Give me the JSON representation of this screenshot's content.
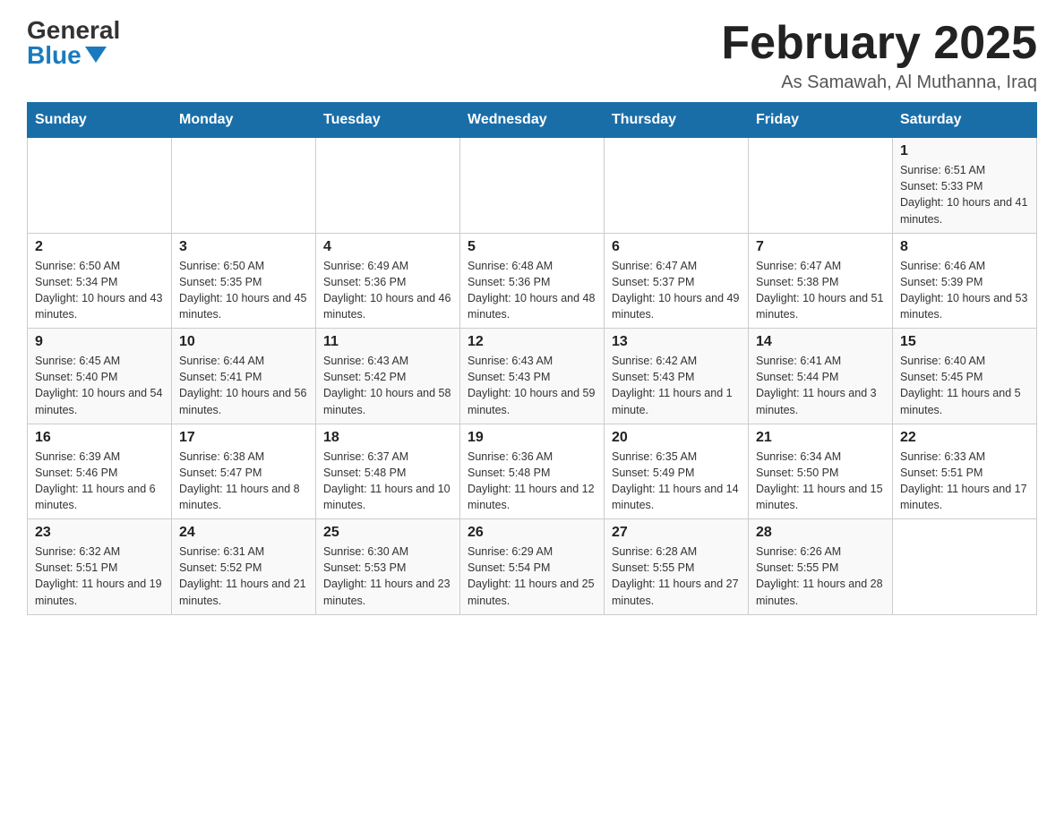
{
  "logo": {
    "general": "General",
    "blue": "Blue"
  },
  "title": "February 2025",
  "location": "As Samawah, Al Muthanna, Iraq",
  "weekdays": [
    "Sunday",
    "Monday",
    "Tuesday",
    "Wednesday",
    "Thursday",
    "Friday",
    "Saturday"
  ],
  "weeks": [
    [
      {
        "day": "",
        "info": ""
      },
      {
        "day": "",
        "info": ""
      },
      {
        "day": "",
        "info": ""
      },
      {
        "day": "",
        "info": ""
      },
      {
        "day": "",
        "info": ""
      },
      {
        "day": "",
        "info": ""
      },
      {
        "day": "1",
        "info": "Sunrise: 6:51 AM\nSunset: 5:33 PM\nDaylight: 10 hours and 41 minutes."
      }
    ],
    [
      {
        "day": "2",
        "info": "Sunrise: 6:50 AM\nSunset: 5:34 PM\nDaylight: 10 hours and 43 minutes."
      },
      {
        "day": "3",
        "info": "Sunrise: 6:50 AM\nSunset: 5:35 PM\nDaylight: 10 hours and 45 minutes."
      },
      {
        "day": "4",
        "info": "Sunrise: 6:49 AM\nSunset: 5:36 PM\nDaylight: 10 hours and 46 minutes."
      },
      {
        "day": "5",
        "info": "Sunrise: 6:48 AM\nSunset: 5:36 PM\nDaylight: 10 hours and 48 minutes."
      },
      {
        "day": "6",
        "info": "Sunrise: 6:47 AM\nSunset: 5:37 PM\nDaylight: 10 hours and 49 minutes."
      },
      {
        "day": "7",
        "info": "Sunrise: 6:47 AM\nSunset: 5:38 PM\nDaylight: 10 hours and 51 minutes."
      },
      {
        "day": "8",
        "info": "Sunrise: 6:46 AM\nSunset: 5:39 PM\nDaylight: 10 hours and 53 minutes."
      }
    ],
    [
      {
        "day": "9",
        "info": "Sunrise: 6:45 AM\nSunset: 5:40 PM\nDaylight: 10 hours and 54 minutes."
      },
      {
        "day": "10",
        "info": "Sunrise: 6:44 AM\nSunset: 5:41 PM\nDaylight: 10 hours and 56 minutes."
      },
      {
        "day": "11",
        "info": "Sunrise: 6:43 AM\nSunset: 5:42 PM\nDaylight: 10 hours and 58 minutes."
      },
      {
        "day": "12",
        "info": "Sunrise: 6:43 AM\nSunset: 5:43 PM\nDaylight: 10 hours and 59 minutes."
      },
      {
        "day": "13",
        "info": "Sunrise: 6:42 AM\nSunset: 5:43 PM\nDaylight: 11 hours and 1 minute."
      },
      {
        "day": "14",
        "info": "Sunrise: 6:41 AM\nSunset: 5:44 PM\nDaylight: 11 hours and 3 minutes."
      },
      {
        "day": "15",
        "info": "Sunrise: 6:40 AM\nSunset: 5:45 PM\nDaylight: 11 hours and 5 minutes."
      }
    ],
    [
      {
        "day": "16",
        "info": "Sunrise: 6:39 AM\nSunset: 5:46 PM\nDaylight: 11 hours and 6 minutes."
      },
      {
        "day": "17",
        "info": "Sunrise: 6:38 AM\nSunset: 5:47 PM\nDaylight: 11 hours and 8 minutes."
      },
      {
        "day": "18",
        "info": "Sunrise: 6:37 AM\nSunset: 5:48 PM\nDaylight: 11 hours and 10 minutes."
      },
      {
        "day": "19",
        "info": "Sunrise: 6:36 AM\nSunset: 5:48 PM\nDaylight: 11 hours and 12 minutes."
      },
      {
        "day": "20",
        "info": "Sunrise: 6:35 AM\nSunset: 5:49 PM\nDaylight: 11 hours and 14 minutes."
      },
      {
        "day": "21",
        "info": "Sunrise: 6:34 AM\nSunset: 5:50 PM\nDaylight: 11 hours and 15 minutes."
      },
      {
        "day": "22",
        "info": "Sunrise: 6:33 AM\nSunset: 5:51 PM\nDaylight: 11 hours and 17 minutes."
      }
    ],
    [
      {
        "day": "23",
        "info": "Sunrise: 6:32 AM\nSunset: 5:51 PM\nDaylight: 11 hours and 19 minutes."
      },
      {
        "day": "24",
        "info": "Sunrise: 6:31 AM\nSunset: 5:52 PM\nDaylight: 11 hours and 21 minutes."
      },
      {
        "day": "25",
        "info": "Sunrise: 6:30 AM\nSunset: 5:53 PM\nDaylight: 11 hours and 23 minutes."
      },
      {
        "day": "26",
        "info": "Sunrise: 6:29 AM\nSunset: 5:54 PM\nDaylight: 11 hours and 25 minutes."
      },
      {
        "day": "27",
        "info": "Sunrise: 6:28 AM\nSunset: 5:55 PM\nDaylight: 11 hours and 27 minutes."
      },
      {
        "day": "28",
        "info": "Sunrise: 6:26 AM\nSunset: 5:55 PM\nDaylight: 11 hours and 28 minutes."
      },
      {
        "day": "",
        "info": ""
      }
    ]
  ]
}
